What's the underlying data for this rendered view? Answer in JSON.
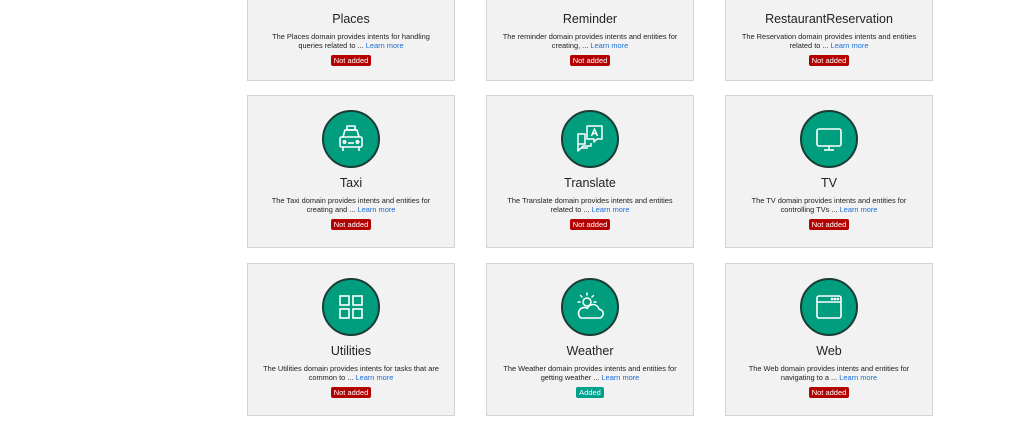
{
  "colors": {
    "accent": "#009e7e",
    "not_added": "#b30000",
    "added": "#00a08a",
    "link": "#1a6ed8"
  },
  "cards": [
    {
      "title": "Places",
      "desc": "The Places domain provides intents for handling queries related to ...",
      "learn": "Learn more",
      "status": "Not added"
    },
    {
      "title": "Reminder",
      "desc": "The reminder domain provides intents and entities for creating, ...",
      "learn": "Learn more",
      "status": "Not added"
    },
    {
      "title": "RestaurantReservation",
      "desc": "The Reservation domain provides intents and entities related to ...",
      "learn": "Learn more",
      "status": "Not added"
    },
    {
      "title": "Taxi",
      "icon": "taxi-icon",
      "desc": "The Taxi domain provides intents and entities for creating and ...",
      "learn": "Learn more",
      "status": "Not added"
    },
    {
      "title": "Translate",
      "icon": "translate-icon",
      "desc": "The Translate domain provides intents and entities related to ...",
      "learn": "Learn more",
      "status": "Not added"
    },
    {
      "title": "TV",
      "icon": "tv-icon",
      "desc": "The TV domain provides intents and entities for controlling TVs ...",
      "learn": "Learn more",
      "status": "Not added"
    },
    {
      "title": "Utilities",
      "icon": "grid-icon",
      "desc": "The Utilities domain provides intents for tasks that are common to ...",
      "learn": "Learn more",
      "status": "Not added"
    },
    {
      "title": "Weather",
      "icon": "weather-icon",
      "desc": "The Weather domain provides intents and entities for getting weather ...",
      "learn": "Learn more",
      "status": "Added"
    },
    {
      "title": "Web",
      "icon": "web-icon",
      "desc": "The Web domain provides intents and entities for navigating to a ...",
      "learn": "Learn more",
      "status": "Not added"
    }
  ]
}
